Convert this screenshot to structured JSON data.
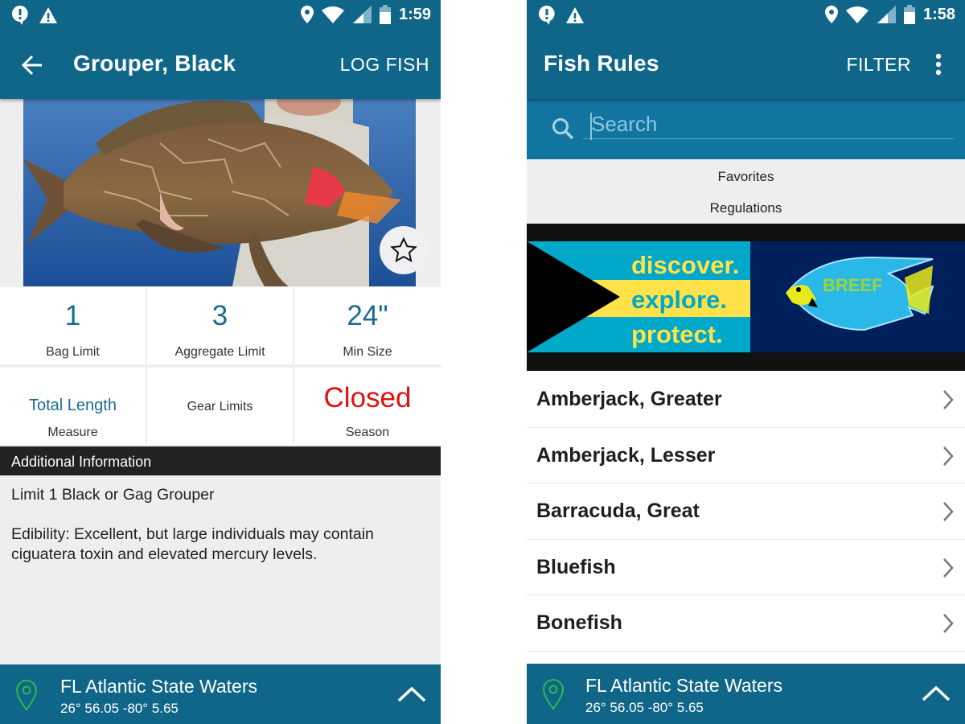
{
  "colors": {
    "primary": "#106689",
    "search_bg": "#1275a0",
    "accent_value": "#1b6b8f",
    "closed": "#e01010",
    "pin": "#2fb84a",
    "banner_cyan": "#00a9c9",
    "banner_yellow": "#ffe24a",
    "banner_navy": "#00205b"
  },
  "left_screen": {
    "status": {
      "time": "1:59",
      "icons": [
        "alert-bubble-icon",
        "warning-icon",
        "location-icon",
        "wifi-icon",
        "signal-icon",
        "battery-icon"
      ]
    },
    "toolbar": {
      "back_icon": "arrow-left-icon",
      "title": "Grouper, Black",
      "action": "LOG FISH"
    },
    "hero": {
      "image": "black-grouper-photo",
      "favorite_icon": "star-outline-icon"
    },
    "stats": [
      {
        "value": "1",
        "label": "Bag Limit"
      },
      {
        "value": "3",
        "label": "Aggregate Limit"
      },
      {
        "value": "24\"",
        "label": "Min Size"
      },
      {
        "value": "Total Length",
        "label": "Measure"
      },
      {
        "value": "",
        "label": "Gear Limits"
      },
      {
        "value": "Closed",
        "label": "Season"
      }
    ],
    "section_header": "Additional Information",
    "info": [
      "Limit 1 Black or Gag Grouper",
      "Edibility: Excellent, but large individuals may contain ciguatera toxin and elevated mercury levels."
    ],
    "location": {
      "name": "FL Atlantic State Waters",
      "coords": "26° 56.05  -80° 5.65"
    }
  },
  "right_screen": {
    "status": {
      "time": "1:58",
      "icons": [
        "alert-bubble-icon",
        "warning-icon",
        "location-icon",
        "wifi-icon",
        "signal-icon",
        "battery-icon"
      ]
    },
    "toolbar": {
      "title": "Fish Rules",
      "action": "FILTER",
      "menu_icon": "more-vert-icon"
    },
    "search": {
      "placeholder": "Search",
      "value": ""
    },
    "tabs": [
      "Favorites",
      "Regulations"
    ],
    "banner": {
      "lines": [
        "discover.",
        "explore.",
        "protect."
      ],
      "logo_text": "BREEF"
    },
    "fish_list": [
      "Amberjack, Greater",
      "Amberjack, Lesser",
      "Barracuda, Great",
      "Bluefish",
      "Bonefish"
    ],
    "location": {
      "name": "FL Atlantic State Waters",
      "coords": "26° 56.05  -80° 5.65"
    }
  }
}
